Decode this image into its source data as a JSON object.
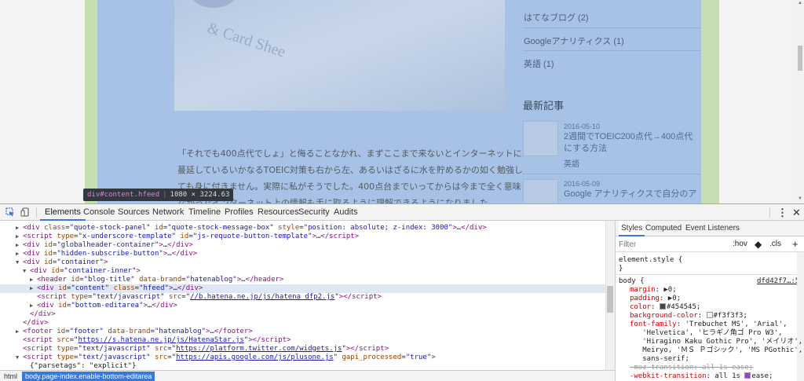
{
  "page": {
    "sidebar_categories": [
      {
        "label": "はてなブログ (2)"
      },
      {
        "label": "Googleアナリティクス (1)"
      },
      {
        "label": "英語 (1)"
      }
    ],
    "recent_heading": "最新記事",
    "recent_posts": [
      {
        "date": "2016-05-10",
        "title": "2週間でTOEIC200点代→400点代にする方法",
        "tag": "英語"
      },
      {
        "date": "2016-05-09",
        "title": "Google アナリティクスで自分のア"
      }
    ],
    "article_lines": [
      "「それでも400点代でしょ」と侮ることなかれ、まずここまで来ないとインターネットに",
      "蔓延しているいかなるTOEIC対策も右から左、あるいはざるに水を貯めるかの如く勉強し",
      "ても身に付きません。実際に私がそうでした。400点台までいってからは今まで全く意味",
      "なかったインターネット上の情報も手に取るように理解できるようになりました。"
    ],
    "tooltip": {
      "tag": "div#content.hfeed",
      "dims": "1080 × 3224.63"
    }
  },
  "devtools": {
    "tabs": [
      "Elements",
      "Console",
      "Sources",
      "Network",
      "Timeline",
      "Profiles",
      "Resources",
      "Security",
      "Audits"
    ],
    "active_tab": "Elements",
    "dom_lines": [
      {
        "indent": 2,
        "tri": "▶",
        "html": "<span class=\"t\">&lt;div</span> <span class=\"a\">class</span>=<span class=\"v\">\"quote-stock-panel\"</span> <span class=\"a\">id</span>=<span class=\"v\">\"quote-stock-message-box\"</span> <span class=\"a\">style</span>=<span class=\"v\">\"position: absolute; z-index: 3000\"</span><span class=\"t\">&gt;</span>…<span class=\"t\">&lt;/div&gt;</span>"
      },
      {
        "indent": 2,
        "tri": "▶",
        "html": "<span class=\"t\">&lt;script</span> <span class=\"a\">type</span>=<span class=\"v\">\"x-underscore-template\"</span> <span class=\"a\">id</span>=<span class=\"v\">\"js-requote-button-template\"</span><span class=\"t\">&gt;</span>…<span class=\"t\">&lt;/script&gt;</span>"
      },
      {
        "indent": 2,
        "tri": "▶",
        "html": "<span class=\"t\">&lt;div</span> <span class=\"a\">id</span>=<span class=\"v\">\"globalheader-container\"</span><span class=\"t\">&gt;</span>…<span class=\"t\">&lt;/div&gt;</span>"
      },
      {
        "indent": 2,
        "tri": "▶",
        "html": "<span class=\"t\">&lt;div</span> <span class=\"a\">id</span>=<span class=\"v\">\"hidden-subscribe-button\"</span><span class=\"t\">&gt;</span>…<span class=\"t\">&lt;/div&gt;</span>"
      },
      {
        "indent": 2,
        "tri": "▼",
        "html": "<span class=\"t\">&lt;div</span> <span class=\"a\">id</span>=<span class=\"v\">\"container\"</span><span class=\"t\">&gt;</span>"
      },
      {
        "indent": 3,
        "tri": "▼",
        "html": "<span class=\"t\">&lt;div</span> <span class=\"a\">id</span>=<span class=\"v\">\"container-inner\"</span><span class=\"t\">&gt;</span>"
      },
      {
        "indent": 4,
        "tri": "▶",
        "html": "<span class=\"t\">&lt;header</span> <span class=\"a\">id</span>=<span class=\"v\">\"blog-title\"</span> <span class=\"a\">data-brand</span>=<span class=\"v\">\"hatenablog\"</span><span class=\"t\">&gt;</span>…<span class=\"t\">&lt;/header&gt;</span>"
      },
      {
        "indent": 4,
        "tri": "▶",
        "sel": true,
        "html": "<span class=\"t\">&lt;div</span> <span class=\"a\">id</span>=<span class=\"v\">\"content\"</span> <span class=\"a\">class</span>=<span class=\"v\">\"hfeed\"</span><span class=\"t\">&gt;</span>…<span class=\"t\">&lt;/div&gt;</span>"
      },
      {
        "indent": 4,
        "tri": "",
        "html": "<span class=\"t\">&lt;script</span> <span class=\"a\">type</span>=<span class=\"v\">\"text/javascript\"</span> <span class=\"a\">src</span>=\"<span class=\"u\">//b.hatena.ne.jp/js/hatena_dfp2.js</span>\"<span class=\"t\">&gt;&lt;/script&gt;</span>"
      },
      {
        "indent": 4,
        "tri": "▶",
        "html": "<span class=\"t\">&lt;div</span> <span class=\"a\">id</span>=<span class=\"v\">\"bottom-editarea\"</span><span class=\"t\">&gt;</span>…<span class=\"t\">&lt;/div&gt;</span>"
      },
      {
        "indent": 3,
        "tri": "",
        "html": "<span class=\"t\">&lt;/div&gt;</span>"
      },
      {
        "indent": 2,
        "tri": "",
        "html": "<span class=\"t\">&lt;/div&gt;</span>"
      },
      {
        "indent": 2,
        "tri": "▶",
        "html": "<span class=\"t\">&lt;footer</span> <span class=\"a\">id</span>=<span class=\"v\">\"footer\"</span> <span class=\"a\">data-brand</span>=<span class=\"v\">\"hatenablog\"</span><span class=\"t\">&gt;</span>…<span class=\"t\">&lt;/footer&gt;</span>"
      },
      {
        "indent": 2,
        "tri": "",
        "html": "<span class=\"t\">&lt;script</span> <span class=\"a\">src</span>=\"<span class=\"u\">https://s.hatena.ne.jp/js/HatenaStar.js</span>\"<span class=\"t\">&gt;&lt;/script&gt;</span>"
      },
      {
        "indent": 2,
        "tri": "",
        "html": "<span class=\"t\">&lt;script</span> <span class=\"a\">type</span>=<span class=\"v\">\"text/javascript\"</span> <span class=\"a\">src</span>=\"<span class=\"u\">https://platform.twitter.com/widgets.js</span>\"<span class=\"t\">&gt;&lt;/script&gt;</span>"
      },
      {
        "indent": 2,
        "tri": "▼",
        "html": "<span class=\"t\">&lt;script</span> <span class=\"a\">type</span>=<span class=\"v\">\"text/javascript\"</span> <span class=\"a\">src</span>=\"<span class=\"u\">https://apis.google.com/js/plusone.js</span>\" <span class=\"a\">gapi_processed</span>=<span class=\"v\">\"true\"</span><span class=\"t\">&gt;</span>"
      },
      {
        "indent": 3,
        "tri": "",
        "html": "<span class=\"tx\">{\"parsetags\": \"explicit\"}</span>"
      }
    ],
    "breadcrumb": {
      "html": "html",
      "body": "body.page-index.enable-bottom-editarea"
    },
    "styles": {
      "tabs": [
        "Styles",
        "Computed",
        "Event Listeners"
      ],
      "filter_placeholder": "Filter",
      "hov": ":hov",
      "cls": ".cls",
      "element_style": "element.style {",
      "close_brace": "}",
      "body_selector": "body {",
      "source": "dfd42f7…:5",
      "props_html": [
        "<span class=\"p\">margin</span>: <span class=\"pv\">▶0;</span>",
        "<span class=\"p\">padding</span>: <span class=\"pv\">▶0;</span>",
        "<span class=\"p\">color</span>: <span class=\"pv\"><span class=\"swatch\" style=\"background:#454545\"></span>#454545;</span>",
        "<span class=\"p\">background-color</span>: <span class=\"pv\"><span class=\"swatch\" style=\"background:#f3f3f3\"></span>#f3f3f3;</span>",
        "<span class=\"p\">font-family</span>: <span class=\"pv\">'Trebuchet MS', 'Arial',</span>",
        "<span class=\"pv\">&nbsp;&nbsp;&nbsp;'Helvetica', 'ヒラギノ角ゴ Pro W3',</span>",
        "<span class=\"pv\">&nbsp;&nbsp;&nbsp;'Hiragino Kaku Gothic Pro', 'メイリオ',</span>",
        "<span class=\"pv\">&nbsp;&nbsp;&nbsp;Meiryo, 'ＭＳ Ｐゴシック', 'MS PGothic',</span>",
        "<span class=\"pv\">&nbsp;&nbsp;&nbsp;sans-serif;</span>",
        "<span class=\"strike\">-moz-transition: all 1s ease;</span>",
        "<span class=\"p\">-webkit-transition</span>: <span class=\"pv\">all 1s <span class=\"swatch\" style=\"background:#a13ed6\"></span>ease;</span>"
      ]
    }
  }
}
